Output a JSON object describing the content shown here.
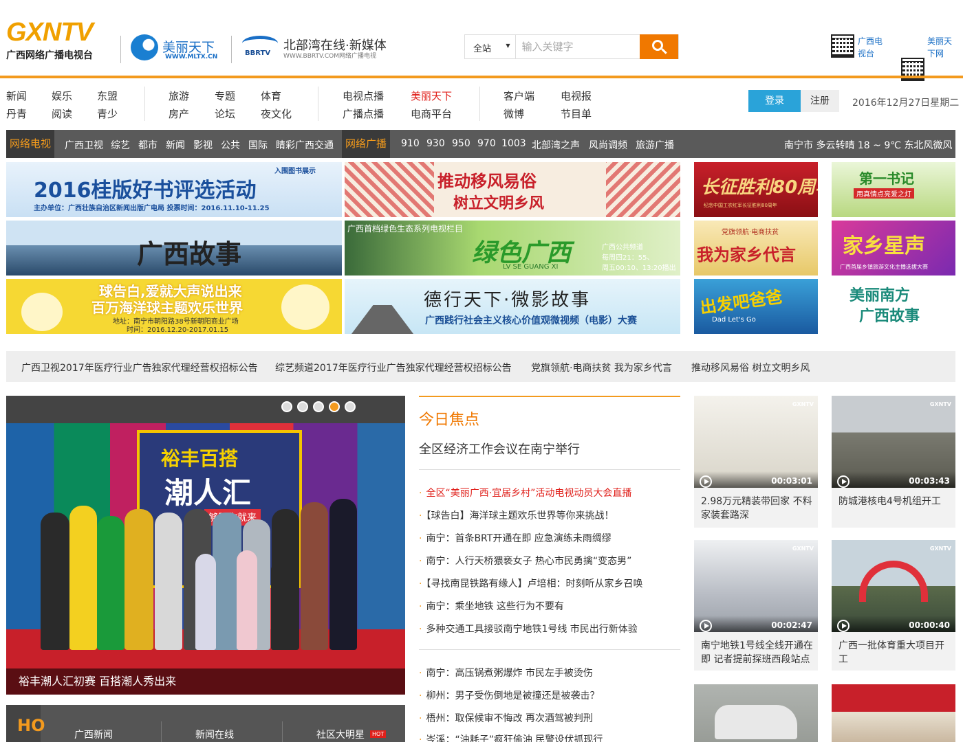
{
  "header": {
    "logo_main": "GXNTV",
    "logo_main_sub": "广西网络广播电视台",
    "logo_mltx": "美丽天下",
    "logo_mltx_url": "WWW.MLTX.CN",
    "logo_bbrtv_mark": "BBRTV",
    "logo_bbrtv": "北部湾在线·新媒体",
    "logo_bbrtv_url": "WWW.BBRTV.COM网络广播电视",
    "search": {
      "scope": "全站",
      "placeholder": "输入关键字"
    },
    "qr": [
      {
        "label": "广西电视台"
      },
      {
        "label": "美丽天下网"
      }
    ]
  },
  "nav": {
    "group1": [
      "新闻",
      "娱乐",
      "东盟",
      "丹青",
      "阅读",
      "青少"
    ],
    "group2": [
      "旅游",
      "专题",
      "体育",
      "房产",
      "论坛",
      "夜文化"
    ],
    "group3": [
      "电视点播",
      "美丽天下",
      "广播点播",
      "电商平台"
    ],
    "group4": [
      "客户端",
      "电视报",
      "微博",
      "节目单"
    ],
    "login": "登录",
    "register": "注册",
    "date": "2016年12月27日星期二"
  },
  "channels": {
    "tv_tab": "网络电视",
    "tv": [
      "广西卫视",
      "综艺",
      "都市",
      "新闻",
      "影视",
      "公共",
      "国际",
      "睛彩广西交通"
    ],
    "radio_tab": "网络广播",
    "radio": [
      "910",
      "930",
      "950",
      "970",
      "1003",
      "北部湾之声",
      "风尚调频",
      "旅游广播"
    ],
    "weather": "南宁市 多云转晴 18 ~ 9℃ 东北风微风"
  },
  "banners": {
    "b1": {
      "title": "2016桂版好书评选活动",
      "tag": "入围图书展示",
      "sub": "主办单位：广西壮族自治区新闻出版广电局  投票时间：2016.11.10-11.25"
    },
    "b2": {
      "title1": "推动移风易俗",
      "title2": "树立文明乡风"
    },
    "b3": {
      "title": "长征胜利80周年",
      "sub": "纪念中国工农红军长征胜利80周年"
    },
    "b4": {
      "title": "第一书记",
      "sub": "用真情点亮爱之灯"
    },
    "b5": {
      "title": "广西故事"
    },
    "b6": {
      "head": "广西首档绿色生态系列电视栏目",
      "title": "绿色广西",
      "pinyin": "LV SE GUANG XI",
      "info1": "广西公共频道",
      "info2": "每周四21：55、",
      "info3": "周五00:10、13:20播出"
    },
    "b7": {
      "head": "党旗领航·电商扶贫",
      "title": "我为家乡代言"
    },
    "b8": {
      "title": "家乡星声",
      "sub": "广西首届乡镇旅游文化主播选拔大赛"
    },
    "b9": {
      "title1": "球告白,爱就大声说出来",
      "title2": "百万海洋球主题欢乐世界",
      "sub1": "地址：南宁市朝阳路38号新朝阳商业广场",
      "sub2": "时间：2016.12.20-2017.01.15"
    },
    "b10": {
      "title": "德行天下·微影故事",
      "sub": "广西践行社会主义核心价值观微视频（电影）大赛"
    },
    "b11": {
      "title": "出发吧爸爸",
      "sub": "Dad Let's Go"
    },
    "b12": {
      "title1": "美丽南方",
      "title2": "广西故事"
    }
  },
  "ticker": [
    "广西卫视2017年医疗行业广告独家代理经营权招标公告",
    "综艺频道2017年医疗行业广告独家代理经营权招标公告",
    "党旗领航·电商扶贫 我为家乡代言",
    "推动移风易俗 树立文明乡风"
  ],
  "slide": {
    "board1": "裕丰百搭",
    "board2": "潮人汇",
    "board3": "够胆你就来",
    "caption": "裕丰潮人汇初赛 百搭潮人秀出来",
    "active_dot": 4
  },
  "hot": {
    "side": "HO",
    "tabs": [
      "广西新闻",
      "新闻在线",
      "社区大明星"
    ],
    "badge": "HOT"
  },
  "focus": {
    "heading": "今日焦点",
    "lead": "全区经济工作会议在南宁举行",
    "list1": [
      "全区“美丽广西·宜居乡村”活动电视动员大会直播",
      "【球告白】海洋球主题欢乐世界等你来挑战！",
      "南宁：首条BRT开通在即 应急演练未雨绸缪",
      "南宁：人行天桥猥亵女子 热心市民勇擒“变态男”",
      "【寻找南昆铁路有缘人】卢培相：时刻听从家乡召唤",
      "南宁：乘坐地铁 这些行为不要有",
      "多种交通工具接驳南宁地铁1号线 市民出行新体验"
    ],
    "list2": [
      "南宁：高压锅煮粥爆炸 市民左手被烫伤",
      "柳州：男子受伤倒地是被撞还是被袭击？",
      "梧州：取保候审不悔改 再次酒驾被判刑",
      "岑溪：“油耗子”疯狂偷油 民警设伏抓现行"
    ]
  },
  "videos": [
    {
      "title": "2.98万元精装带回家 不料家装套路深",
      "duration": "00:03:01",
      "wm": "GXNTV"
    },
    {
      "title": "防城港核电4号机组开工",
      "duration": "00:03:43",
      "wm": "GXNTV"
    },
    {
      "title": "南宁地铁1号线全线开通在即 记者提前探班西段站点",
      "duration": "00:02:47",
      "wm": "GXNTV"
    },
    {
      "title": "广西一批体育重大项目开工",
      "duration": "00:00:40",
      "wm": "GXNTV"
    },
    {
      "title": "",
      "duration": "",
      "wm": ""
    },
    {
      "title": "",
      "duration": "",
      "wm": ""
    }
  ]
}
